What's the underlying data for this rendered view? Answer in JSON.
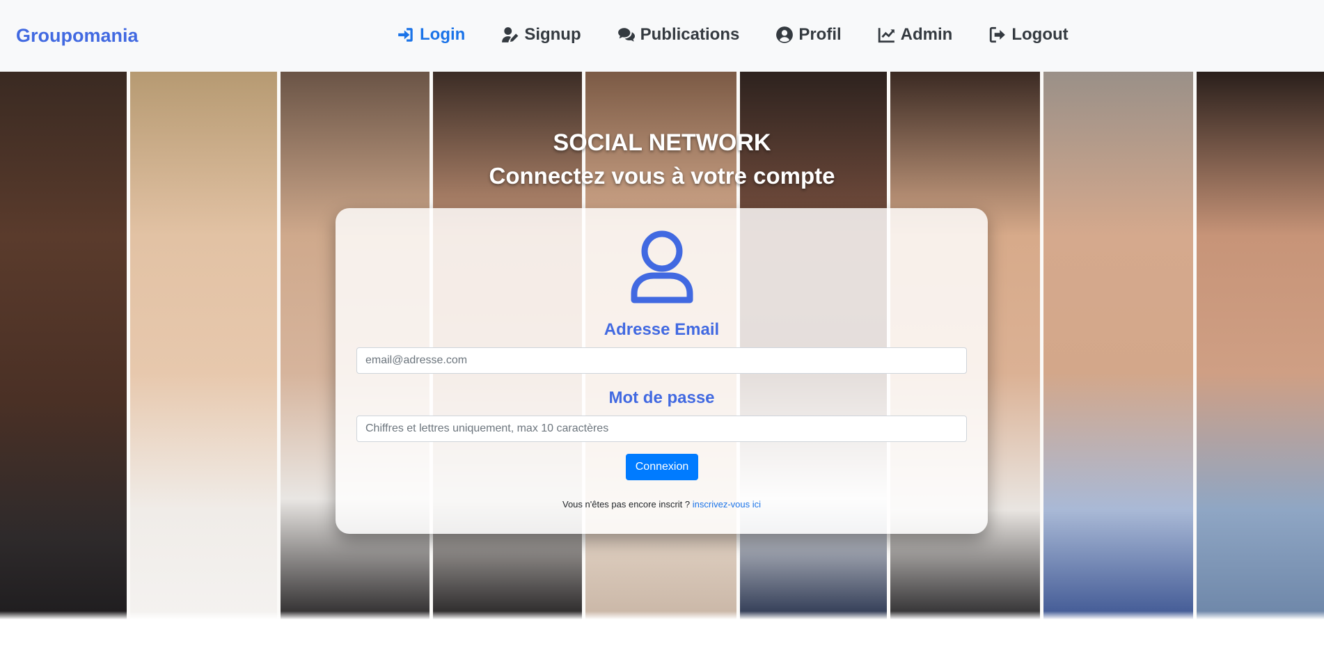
{
  "brand": "Groupomania",
  "nav": {
    "login": "Login",
    "signup": "Signup",
    "publications": "Publications",
    "profil": "Profil",
    "admin": "Admin",
    "logout": "Logout"
  },
  "hero": {
    "title": "SOCIAL NETWORK",
    "subtitle": "Connectez vous à votre compte"
  },
  "form": {
    "email_label": "Adresse Email",
    "email_placeholder": "email@adresse.com",
    "password_label": "Mot de passe",
    "password_placeholder": "Chiffres et lettres uniquement, max 10 caractères",
    "submit_label": "Connexion",
    "signup_prompt": "Vous n'êtes pas encore inscrit ?",
    "signup_link": "inscrivez-vous ici"
  },
  "colors": {
    "brand": "#4169e1",
    "active_nav": "#1a73e8",
    "button": "#007bff"
  }
}
